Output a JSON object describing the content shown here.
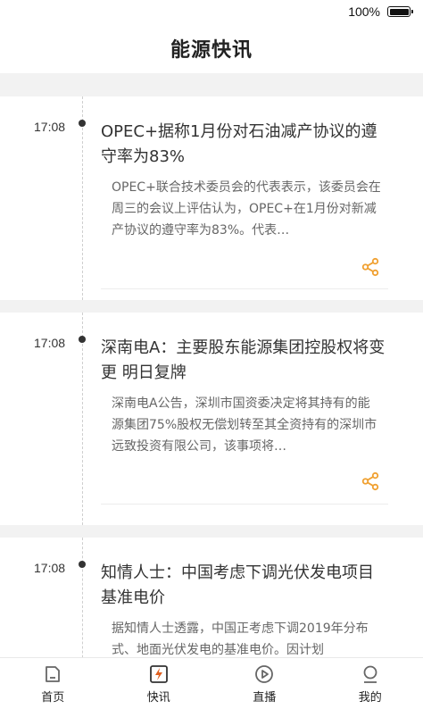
{
  "status_bar": {
    "battery": "100%"
  },
  "header": {
    "title": "能源快讯"
  },
  "news": [
    {
      "time": "17:08",
      "title": "OPEC+据称1月份对石油减产协议的遵守率为83%",
      "summary": "OPEC+联合技术委员会的代表表示，该委员会在周三的会议上评估认为，OPEC+在1月份对新减产协议的遵守率为83%。代表…"
    },
    {
      "time": "17:08",
      "title": "深南电A：主要股东能源集团控股权将变更 明日复牌",
      "summary": "深南电A公告，深圳市国资委决定将其持有的能源集团75%股权无偿划转至其全资持有的深圳市远致投资有限公司，该事项将…"
    },
    {
      "time": "17:08",
      "title": "知情人士：中国考虑下调光伏发电项目基准电价",
      "summary": "据知情人士透露，中国正考虑下调2019年分布式、地面光伏发电的基准电价。因计划"
    }
  ],
  "colors": {
    "accent": "#f0a030",
    "active_icon": "#e06020"
  },
  "tab_bar": [
    {
      "label": "首页",
      "icon": "home-icon"
    },
    {
      "label": "快讯",
      "icon": "flash-news-icon"
    },
    {
      "label": "直播",
      "icon": "play-circle-icon"
    },
    {
      "label": "我的",
      "icon": "user-icon"
    }
  ]
}
